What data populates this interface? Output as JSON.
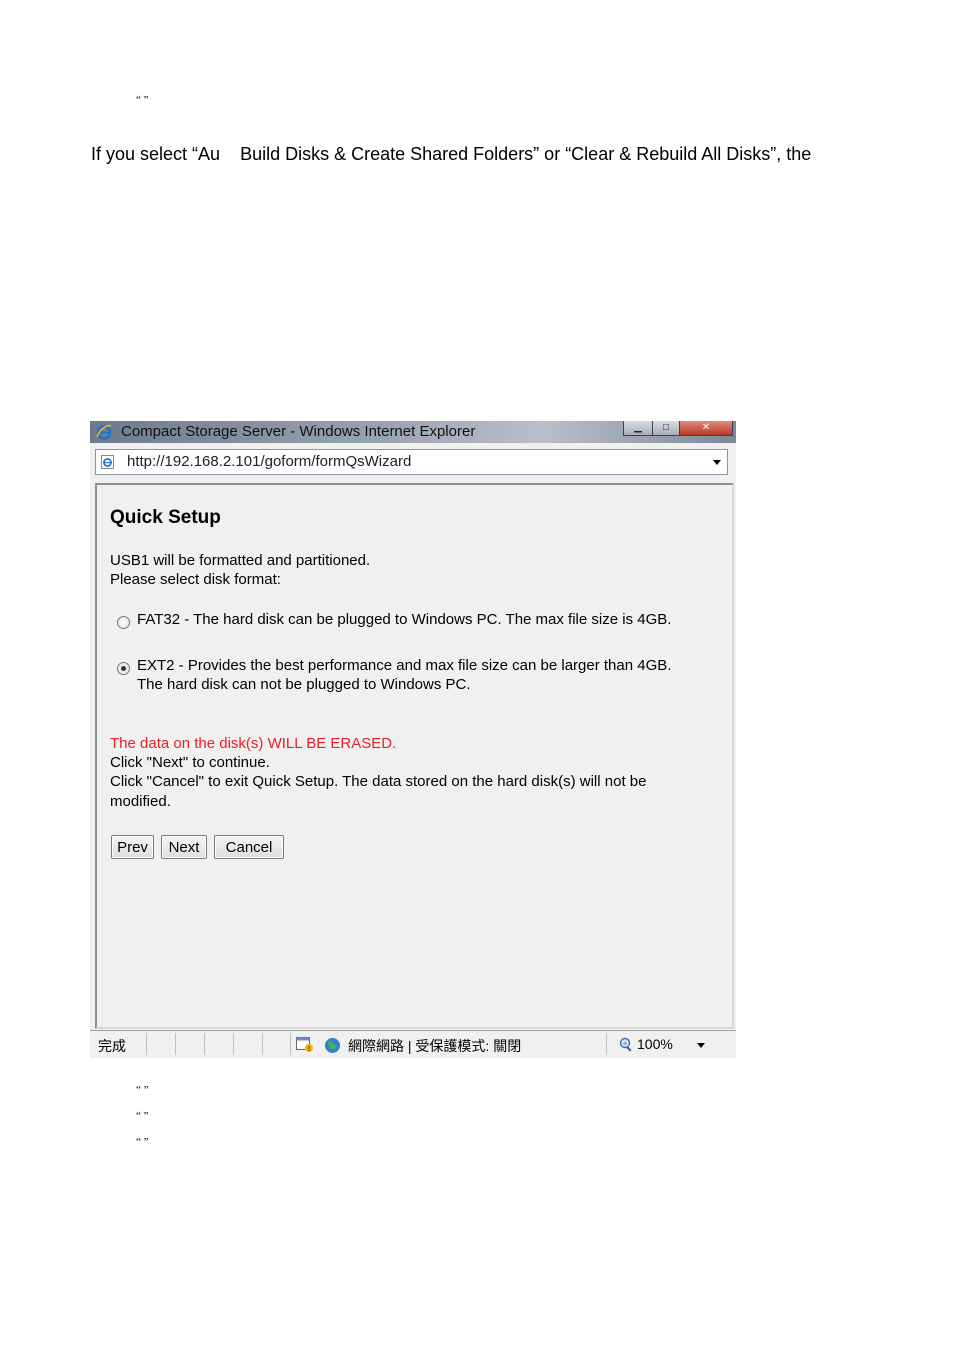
{
  "doc": {
    "top_quote": "“          ”",
    "intro": "If you select “Au    Build Disks & Create Shared Folders” or “Clear & Rebuild All Disks”, the",
    "bottom_quotes": [
      "“        ”",
      "“        ”",
      "“          ”"
    ]
  },
  "window": {
    "title": "Compact Storage Server - Windows Internet Explorer",
    "url": "http://192.168.2.101/goform/formQsWizard"
  },
  "page": {
    "heading": "Quick Setup",
    "line1": "USB1 will be formatted and partitioned.",
    "line2": "Please select disk format:",
    "options": [
      {
        "label": "FAT32 - The hard disk can be plugged to Windows PC. The max file size is 4GB.",
        "selected": false
      },
      {
        "label": "EXT2 - Provides the best performance and max file size can be larger than 4GB.",
        "label2": "The hard disk can not be plugged to Windows PC.",
        "selected": true
      }
    ],
    "warning": "The data on the disk(s) WILL BE ERASED.",
    "next_hint": "Click \"Next\" to continue.",
    "cancel_hint": "Click \"Cancel\" to exit Quick Setup. The data stored on the hard disk(s) will not be",
    "cancel_hint2": "modified.",
    "buttons": {
      "prev": "Prev",
      "next": "Next",
      "cancel": "Cancel"
    }
  },
  "status": {
    "done": "完成",
    "zone": "網際網路 | 受保護模式: 關閉",
    "zoom": "100%"
  },
  "colors": {
    "warning": "#e8202a"
  }
}
